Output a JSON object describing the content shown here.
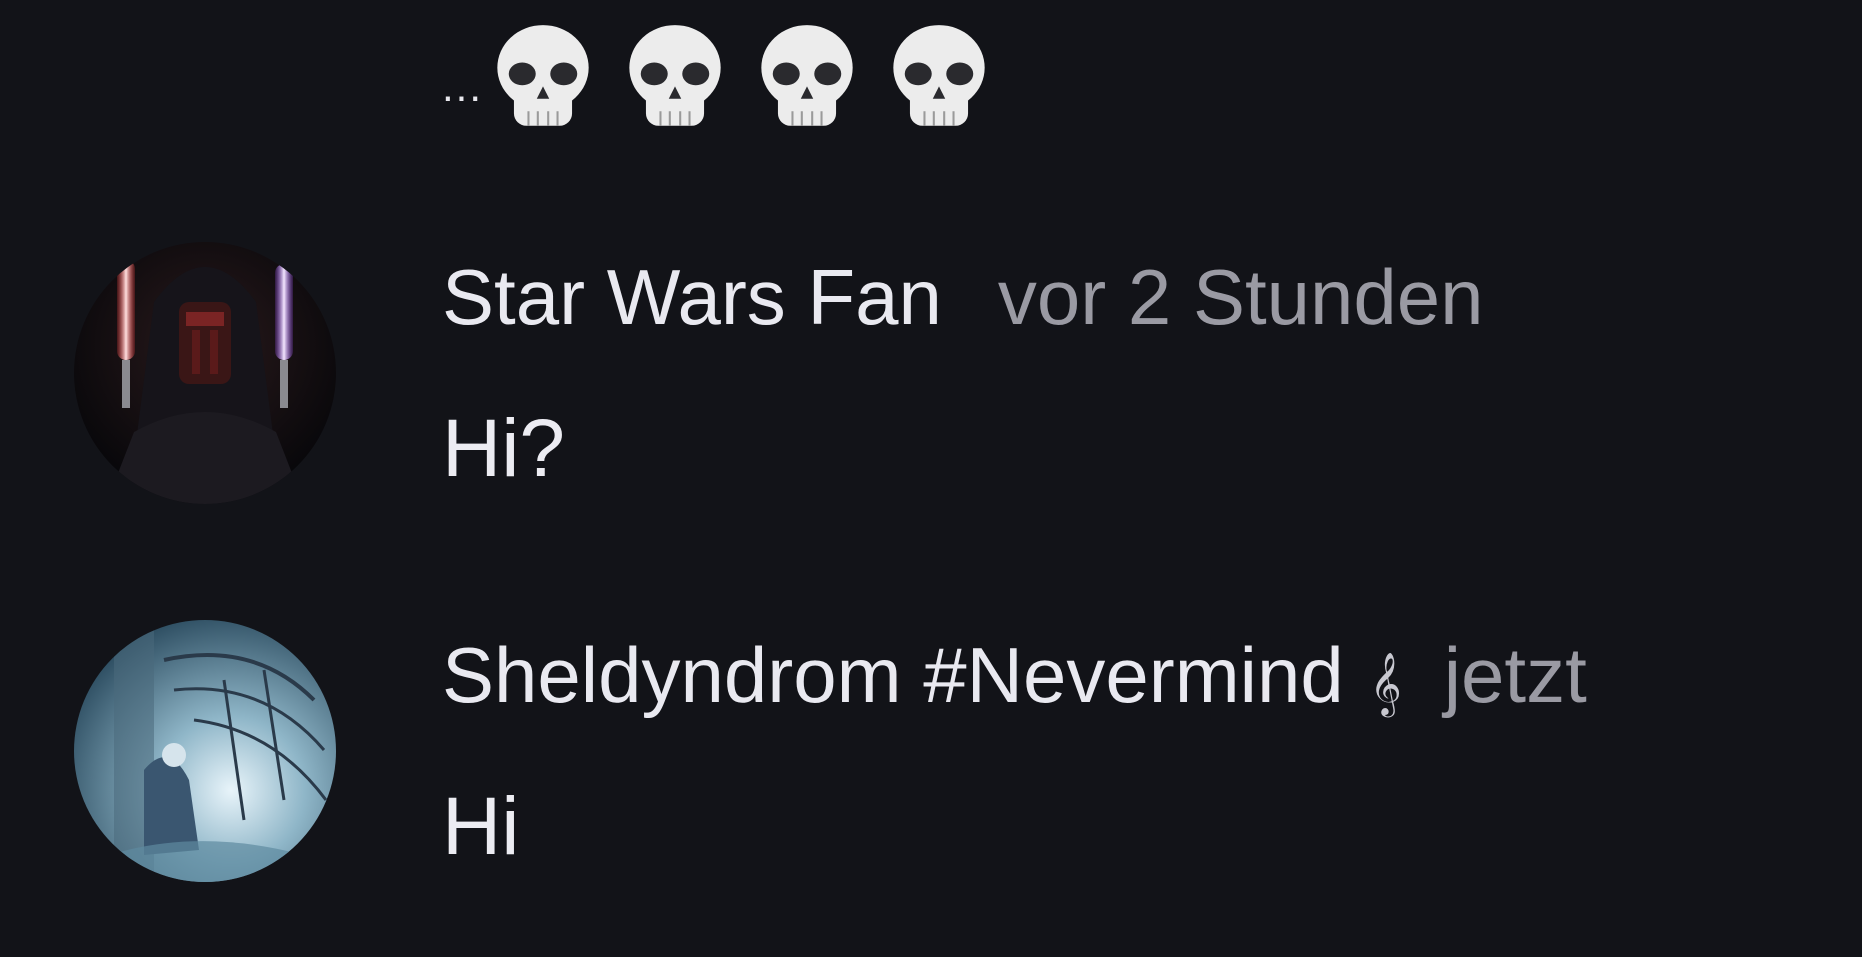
{
  "previous_message": {
    "text": "...",
    "emojis": [
      "skull-icon",
      "skull-icon",
      "skull-icon",
      "skull-icon"
    ]
  },
  "messages": [
    {
      "username": "Star Wars Fan",
      "timestamp": "vor 2 Stunden",
      "text": "Hi?",
      "avatar": "sith-lord-avatar",
      "badge": null
    },
    {
      "username": "Sheldyndrom #Nevermind",
      "timestamp": "jetzt",
      "text": "Hi",
      "avatar": "fantasy-art-avatar",
      "badge": "treble-clef-icon",
      "badge_glyph": "𝄞"
    }
  ],
  "colors": {
    "background": "#121318",
    "text": "#e9e9f0",
    "timestamp": "#9a9aa3"
  }
}
